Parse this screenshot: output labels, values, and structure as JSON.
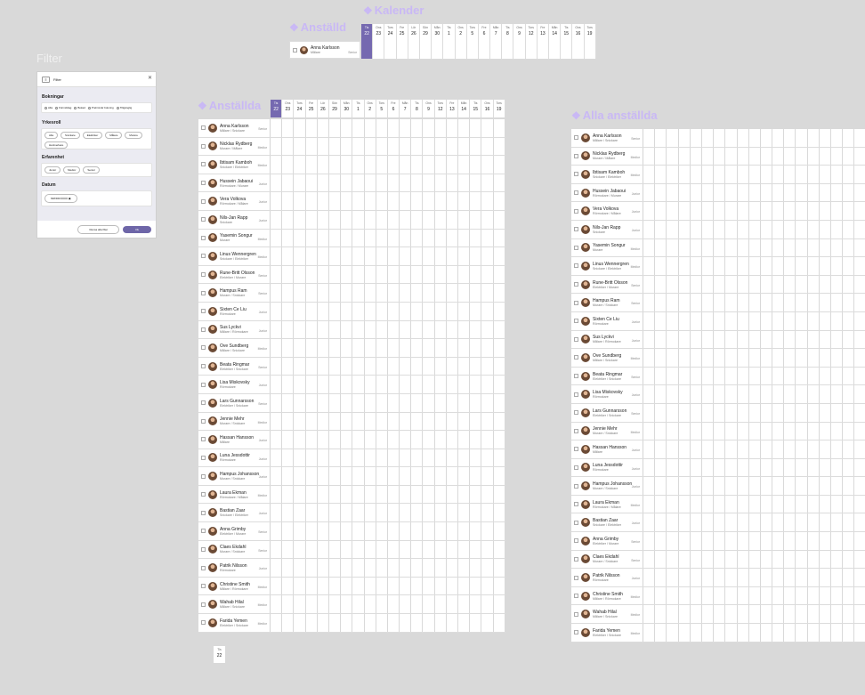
{
  "titles": {
    "kalender": "Kalender",
    "anstalld": "Anställd",
    "anstallda": "Anställda",
    "alla": "Alla anställda",
    "filter": "Filter"
  },
  "filter": {
    "header": "Filter",
    "bokningar": {
      "title": "Bokningar",
      "options": [
        "Alla",
        "Förmiddag",
        "Bokad",
        "Preliminär bokning",
        "Tillgänglig"
      ]
    },
    "yrkesroll": {
      "title": "Yrkesroll",
      "chips": [
        "Alla",
        "Snickare",
        "Elektriker",
        "Målare",
        "Murare",
        "Hantverkare"
      ]
    },
    "erfarenhet": {
      "title": "Erfarenhet",
      "chips": [
        "Junior",
        "Medior",
        "Senior"
      ]
    },
    "datum": {
      "title": "Datum",
      "value": "MM/DD/ÅÅÅÅ"
    },
    "clear_label": "Rensa alla filter",
    "ok_label": "Ok"
  },
  "top_calendar": {
    "days": [
      {
        "dn": "Tis",
        "dd": "22"
      },
      {
        "dn": "Ons",
        "dd": "23"
      },
      {
        "dn": "Tors",
        "dd": "24"
      },
      {
        "dn": "Fre",
        "dd": "25"
      },
      {
        "dn": "Lör",
        "dd": "26"
      },
      {
        "dn": "Sön",
        "dd": "29"
      },
      {
        "dn": "Mån",
        "dd": "30"
      },
      {
        "dn": "Tis",
        "dd": "1"
      },
      {
        "dn": "Ons",
        "dd": "2"
      },
      {
        "dn": "Tors",
        "dd": "5"
      },
      {
        "dn": "Fre",
        "dd": "6"
      },
      {
        "dn": "Mån",
        "dd": "7"
      },
      {
        "dn": "Tis",
        "dd": "8"
      },
      {
        "dn": "Ons",
        "dd": "9"
      },
      {
        "dn": "Tors",
        "dd": "12"
      },
      {
        "dn": "Fre",
        "dd": "13"
      },
      {
        "dn": "Mån",
        "dd": "14"
      },
      {
        "dn": "Tis",
        "dd": "15"
      },
      {
        "dn": "Ons",
        "dd": "16"
      },
      {
        "dn": "Tors",
        "dd": "19"
      }
    ],
    "employee": {
      "name": "Anna Karlsson",
      "role": "Målare",
      "level": "Senior"
    }
  },
  "mid_calendar": {
    "days": [
      {
        "dn": "Tis",
        "dd": "22"
      },
      {
        "dn": "Ons",
        "dd": "23"
      },
      {
        "dn": "Tors",
        "dd": "24"
      },
      {
        "dn": "Fre",
        "dd": "25"
      },
      {
        "dn": "Lör",
        "dd": "26"
      },
      {
        "dn": "Sön",
        "dd": "29"
      },
      {
        "dn": "Mån",
        "dd": "30"
      },
      {
        "dn": "Tis",
        "dd": "1"
      },
      {
        "dn": "Ons",
        "dd": "2"
      },
      {
        "dn": "Tors",
        "dd": "5"
      },
      {
        "dn": "Fre",
        "dd": "6"
      },
      {
        "dn": "Mån",
        "dd": "7"
      },
      {
        "dn": "Tis",
        "dd": "8"
      },
      {
        "dn": "Ons",
        "dd": "9"
      },
      {
        "dn": "Tors",
        "dd": "12"
      },
      {
        "dn": "Fre",
        "dd": "13"
      },
      {
        "dn": "Mån",
        "dd": "14"
      },
      {
        "dn": "Tis",
        "dd": "15"
      },
      {
        "dn": "Ons",
        "dd": "16"
      },
      {
        "dn": "Tors",
        "dd": "19"
      }
    ]
  },
  "employees": [
    {
      "name": "Anna Karlsson",
      "role": "Målare / Snickare",
      "level": "Senior"
    },
    {
      "name": "Nicklas Rydberg",
      "role": "Murare / Målare",
      "level": "Medior"
    },
    {
      "name": "Ibtisam Kamboh",
      "role": "Snickare / Elektriker",
      "level": "Medior"
    },
    {
      "name": "Hussein Jabaoui",
      "role": "Rörmokare / Murare",
      "level": "Junior"
    },
    {
      "name": "Vera Volkova",
      "role": "Rörmokare / Målare",
      "level": "Junior"
    },
    {
      "name": "Nils-Jan Rapp",
      "role": "Snickare",
      "level": "Junior"
    },
    {
      "name": "Yasemin Songur",
      "role": "Murare",
      "level": "Medior"
    },
    {
      "name": "Linus Wennergren",
      "role": "Snickare / Elektriker",
      "level": "Medior"
    },
    {
      "name": "Rune-Britt Olsson",
      "role": "Elektriker / Murare",
      "level": "Senior"
    },
    {
      "name": "Hampus Ram",
      "role": "Murare / Snickare",
      "level": "Senior"
    },
    {
      "name": "Sixten Ce Liu",
      "role": "Rörmokare",
      "level": "Junior"
    },
    {
      "name": "Sus Lyckvi",
      "role": "Målare / Rörmokare",
      "level": "Junior"
    },
    {
      "name": "Ove Sundberg",
      "role": "Målare / Snickare",
      "level": "Medior"
    },
    {
      "name": "Beata Ringmar",
      "role": "Elektriker / Snickare",
      "level": "Senior"
    },
    {
      "name": "Lisa Miskovsky",
      "role": "Rörmokare",
      "level": "Junior"
    },
    {
      "name": "Lars Gunnarsson",
      "role": "Elektriker / Snickare",
      "level": "Senior"
    },
    {
      "name": "Jennie Mehr",
      "role": "Murare / Snickare",
      "level": "Medior"
    },
    {
      "name": "Hassan Hansson",
      "role": "Målare",
      "level": "Junior"
    },
    {
      "name": "Luna Jessdottir",
      "role": "Rörmokare",
      "level": "Junior"
    },
    {
      "name": "Hampus Johansson",
      "role": "Murare / Snickare",
      "level": "Junior"
    },
    {
      "name": "Laura Ekman",
      "role": "Rörmokare / Målare",
      "level": "Medior"
    },
    {
      "name": "Bastian Zaar",
      "role": "Snickare / Elektriker",
      "level": "Junior"
    },
    {
      "name": "Anna Grimby",
      "role": "Elektriker / Murare",
      "level": "Senior"
    },
    {
      "name": "Claes Ekdahl",
      "role": "Murare / Snickare",
      "level": "Senior"
    },
    {
      "name": "Patrik Nilsson",
      "role": "Rörmokare",
      "level": "Junior"
    },
    {
      "name": "Christine Smith",
      "role": "Målare / Rörmokare",
      "level": "Medior"
    },
    {
      "name": "Wahab Hilal",
      "role": "Målare / Snickare",
      "level": "Medior"
    },
    {
      "name": "Farida Yemen",
      "role": "Elektriker / Snickare",
      "level": "Medior"
    }
  ],
  "mini_day": {
    "dn": "Tis",
    "dd": "22"
  },
  "colors": {
    "accent": "#7569b0",
    "title": "#c9b8f5"
  }
}
